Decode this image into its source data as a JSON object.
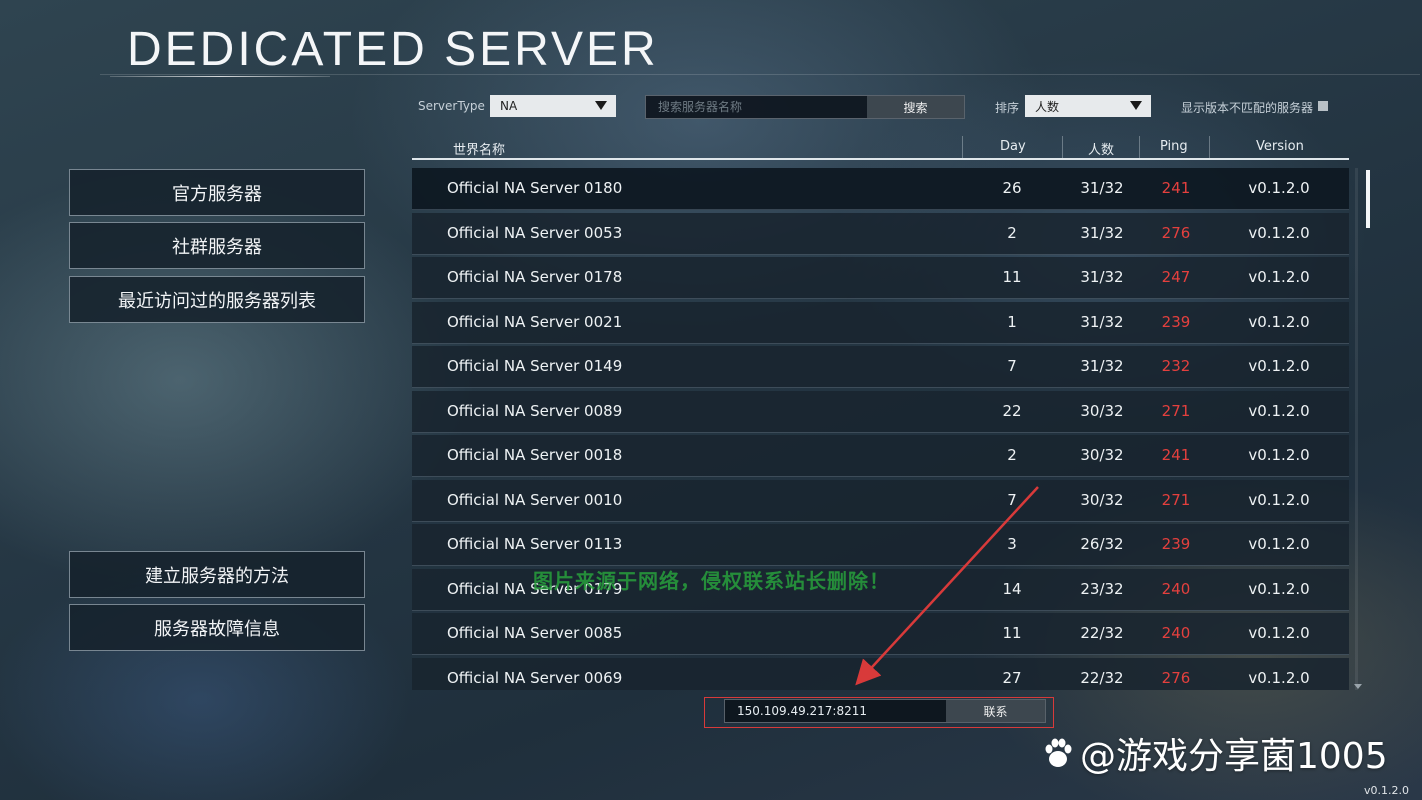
{
  "title": "DEDICATED SERVER",
  "nav": {
    "official": "官方服务器",
    "community": "社群服务器",
    "recent": "最近访问过的服务器列表",
    "howto": "建立服务器的方法",
    "issues": "服务器故障信息"
  },
  "filters": {
    "server_type_label": "ServerType",
    "server_type_value": "NA",
    "search_placeholder": "搜索服务器名称",
    "search_button": "搜索",
    "sort_label": "排序",
    "sort_value": "人数",
    "show_mismatch_label": "显示版本不匹配的服务器"
  },
  "table": {
    "headers": {
      "name": "世界名称",
      "day": "Day",
      "players": "人数",
      "ping": "Ping",
      "version": "Version"
    },
    "rows": [
      {
        "name": "Official NA Server 0180",
        "day": "26",
        "players": "31/32",
        "ping": "241",
        "version": "v0.1.2.0"
      },
      {
        "name": "Official NA Server 0053",
        "day": "2",
        "players": "31/32",
        "ping": "276",
        "version": "v0.1.2.0"
      },
      {
        "name": "Official NA Server 0178",
        "day": "11",
        "players": "31/32",
        "ping": "247",
        "version": "v0.1.2.0"
      },
      {
        "name": "Official NA Server 0021",
        "day": "1",
        "players": "31/32",
        "ping": "239",
        "version": "v0.1.2.0"
      },
      {
        "name": "Official NA Server 0149",
        "day": "7",
        "players": "31/32",
        "ping": "232",
        "version": "v0.1.2.0"
      },
      {
        "name": "Official NA Server 0089",
        "day": "22",
        "players": "30/32",
        "ping": "271",
        "version": "v0.1.2.0"
      },
      {
        "name": "Official NA Server 0018",
        "day": "2",
        "players": "30/32",
        "ping": "241",
        "version": "v0.1.2.0"
      },
      {
        "name": "Official NA Server 0010",
        "day": "7",
        "players": "30/32",
        "ping": "271",
        "version": "v0.1.2.0"
      },
      {
        "name": "Official NA Server 0113",
        "day": "3",
        "players": "26/32",
        "ping": "239",
        "version": "v0.1.2.0"
      },
      {
        "name": "Official NA Server 0179",
        "day": "14",
        "players": "23/32",
        "ping": "240",
        "version": "v0.1.2.0"
      },
      {
        "name": "Official NA Server 0085",
        "day": "11",
        "players": "22/32",
        "ping": "240",
        "version": "v0.1.2.0"
      },
      {
        "name": "Official NA Server 0069",
        "day": "27",
        "players": "22/32",
        "ping": "276",
        "version": "v0.1.2.0"
      }
    ]
  },
  "connect": {
    "address_value": "150.109.49.217:8211",
    "button": "联系"
  },
  "overlay": {
    "watermark": "图片来源于网络，侵权联系站长删除！",
    "brand": "@游戏分享菌1005"
  },
  "footer_version": "v0.1.2.0",
  "colors": {
    "ping": "#e4403e",
    "annotation": "#d83a3a",
    "watermark": "#28a03c"
  }
}
